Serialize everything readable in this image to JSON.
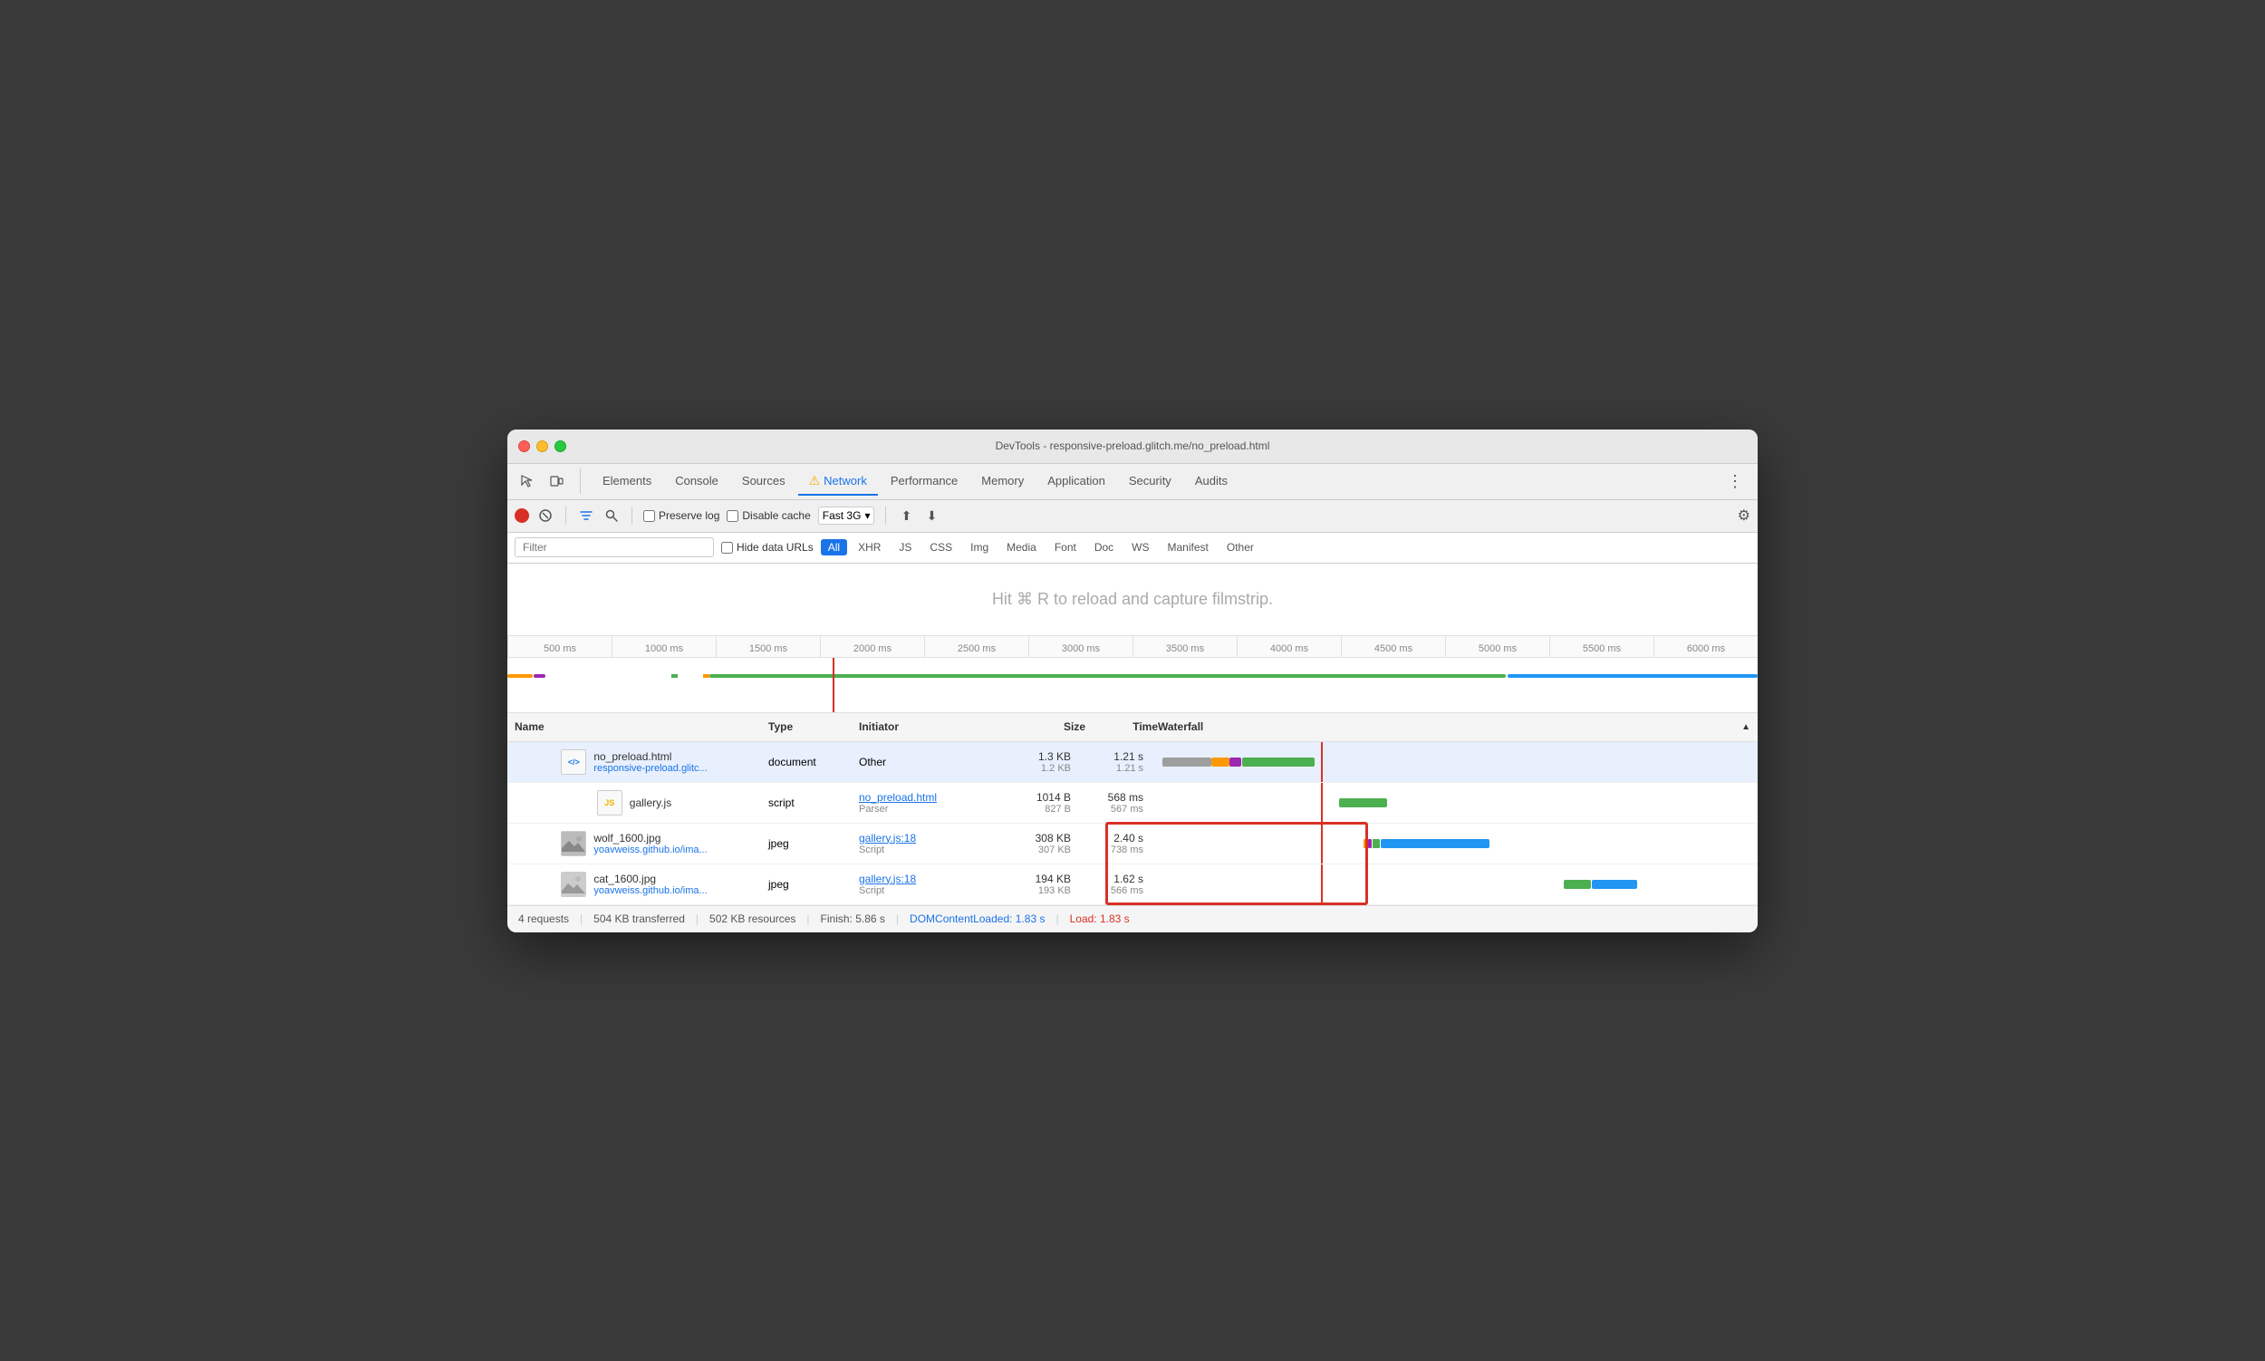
{
  "window": {
    "title": "DevTools - responsive-preload.glitch.me/no_preload.html"
  },
  "tabs": {
    "items": [
      "Elements",
      "Console",
      "Sources",
      "Network",
      "Performance",
      "Memory",
      "Application",
      "Security",
      "Audits"
    ],
    "active": "Network",
    "active_warning": true
  },
  "toolbar": {
    "preserve_log_label": "Preserve log",
    "disable_cache_label": "Disable cache",
    "throttle_label": "Fast 3G",
    "throttle_icon": "▾"
  },
  "filter_bar": {
    "filter_placeholder": "Filter",
    "hide_data_urls_label": "Hide data URLs",
    "types": [
      "All",
      "XHR",
      "JS",
      "CSS",
      "Img",
      "Media",
      "Font",
      "Doc",
      "WS",
      "Manifest",
      "Other"
    ],
    "active_type": "All"
  },
  "filmstrip": {
    "message": "Hit ⌘ R to reload and capture filmstrip."
  },
  "timeline": {
    "ticks": [
      "500 ms",
      "1000 ms",
      "1500 ms",
      "2000 ms",
      "2500 ms",
      "3000 ms",
      "3500 ms",
      "4000 ms",
      "4500 ms",
      "5000 ms",
      "5500 ms",
      "6000 ms"
    ]
  },
  "table": {
    "headers": {
      "name": "Name",
      "type": "Type",
      "initiator": "Initiator",
      "size": "Size",
      "time": "Time",
      "waterfall": "Waterfall"
    },
    "rows": [
      {
        "icon": "doc",
        "name": "no_preload.html",
        "domain": "responsive-preload.glitc...",
        "type": "document",
        "initiator": "Other",
        "initiator_link": false,
        "size_main": "1.3 KB",
        "size_sub": "1.2 KB",
        "time_main": "1.21 s",
        "time_sub": "1.21 s",
        "selected": true
      },
      {
        "icon": "js",
        "name": "gallery.js",
        "domain": "",
        "type": "script",
        "initiator": "no_preload.html",
        "initiator_sub": "Parser",
        "initiator_link": true,
        "size_main": "1014 B",
        "size_sub": "827 B",
        "time_main": "568 ms",
        "time_sub": "567 ms",
        "selected": false
      },
      {
        "icon": "img",
        "name": "wolf_1600.jpg",
        "domain": "yoavweiss.github.io/ima...",
        "type": "jpeg",
        "initiator": "gallery.js:18",
        "initiator_sub": "Script",
        "initiator_link": true,
        "size_main": "308 KB",
        "size_sub": "307 KB",
        "time_main": "2.40 s",
        "time_sub": "738 ms",
        "selected": false
      },
      {
        "icon": "img",
        "name": "cat_1600.jpg",
        "domain": "yoavweiss.github.io/ima...",
        "type": "jpeg",
        "initiator": "gallery.js:18",
        "initiator_sub": "Script",
        "initiator_link": true,
        "size_main": "194 KB",
        "size_sub": "193 KB",
        "time_main": "1.62 s",
        "time_sub": "566 ms",
        "selected": false
      }
    ]
  },
  "status_bar": {
    "requests": "4 requests",
    "transferred": "504 KB transferred",
    "resources": "502 KB resources",
    "finish": "Finish: 5.86 s",
    "dom_content_loaded": "DOMContentLoaded: 1.83 s",
    "load": "Load: 1.83 s"
  }
}
